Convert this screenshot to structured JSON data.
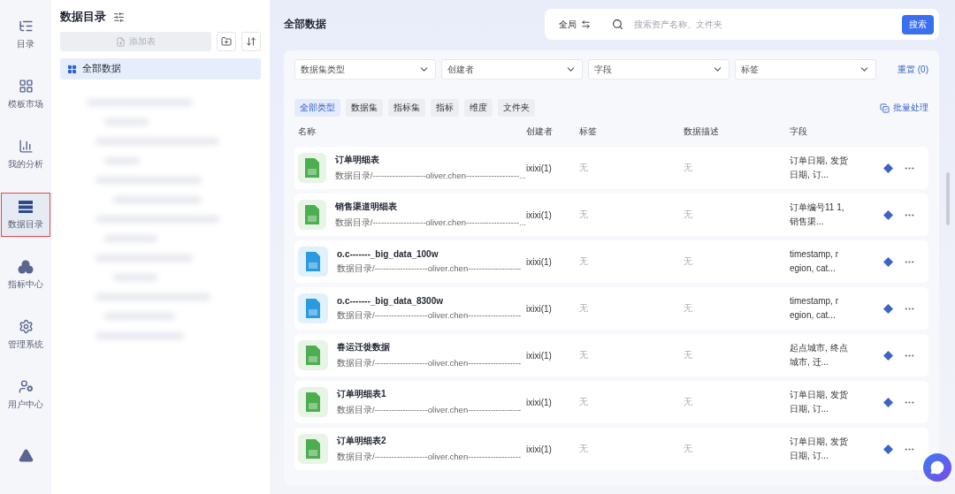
{
  "nav": {
    "items": [
      {
        "label": "目录",
        "selected": false
      },
      {
        "label": "模板市场",
        "selected": false
      },
      {
        "label": "我的分析",
        "selected": false
      },
      {
        "label": "数据目录",
        "selected": true
      },
      {
        "label": "指标中心",
        "selected": false
      },
      {
        "label": "管理系统",
        "selected": false
      },
      {
        "label": "用户中心",
        "selected": false
      },
      {
        "selected": false
      }
    ]
  },
  "tree": {
    "title": "数据目录",
    "add_button": "添加表",
    "items": [
      {
        "label": "全部数据",
        "selected": true
      }
    ]
  },
  "main": {
    "title": "全部数据",
    "search": {
      "scope": "全局",
      "placeholder": "搜索资产名称、文件夹",
      "button": "搜索"
    },
    "filters": [
      "数据集类型",
      "创建者",
      "字段",
      "标签"
    ],
    "reset": "重置 (0)",
    "types": [
      {
        "label": "全部类型",
        "selected": true
      },
      {
        "label": "数据集",
        "selected": false
      },
      {
        "label": "指标集",
        "selected": false
      },
      {
        "label": "指标",
        "selected": false
      },
      {
        "label": "维度",
        "selected": false
      },
      {
        "label": "文件夹",
        "selected": false
      }
    ],
    "batch": "批量处理",
    "table": {
      "columns": [
        "名称",
        "创建者",
        "标签",
        "数据描述",
        "字段"
      ],
      "rows": [
        {
          "kind": "xls",
          "name": "订单明细表",
          "path": "数据目录/-------------------oliver.chen-------------------...",
          "creator": "ixixi(1)",
          "tags": "无",
          "description": "无",
          "fields": "订单日期, 发货日期, 订..."
        },
        {
          "kind": "xls",
          "name": "销售渠道明细表",
          "path": "数据目录/-------------------oliver.chen-------------------...",
          "creator": "ixixi(1)",
          "tags": "无",
          "description": "无",
          "fields": "订单编号11 1, 销售渠..."
        },
        {
          "kind": "db",
          "name": "o.c-------_big_data_100w",
          "path": "数据目录/-------------------oliver.chen-------------------",
          "creator": "ixixi(1)",
          "tags": "无",
          "description": "无",
          "fields": "timestamp, r egion, cat..."
        },
        {
          "kind": "db",
          "name": "o.c-------_big_data_8300w",
          "path": "数据目录/-------------------oliver.chen-------------------",
          "creator": "ixixi(1)",
          "tags": "无",
          "description": "无",
          "fields": "timestamp, r egion, cat..."
        },
        {
          "kind": "xls",
          "name": "春运迁徙数据",
          "path": "数据目录/-------------------oliver.chen-------------------",
          "creator": "ixixi(1)",
          "tags": "无",
          "description": "无",
          "fields": "起点城市, 终点城市, 迁..."
        },
        {
          "kind": "xls",
          "name": "订单明细表1",
          "path": "数据目录/-------------------oliver.chen-------------------",
          "creator": "ixixi(1)",
          "tags": "无",
          "description": "无",
          "fields": "订单日期, 发货日期, 订..."
        },
        {
          "kind": "xls",
          "name": "订单明细表2",
          "path": "数据目录/-------------------oliver.chen-------------------",
          "creator": "ixixi(1)",
          "tags": "无",
          "description": "无",
          "fields": "订单日期, 发货日期, 订..."
        }
      ]
    }
  }
}
